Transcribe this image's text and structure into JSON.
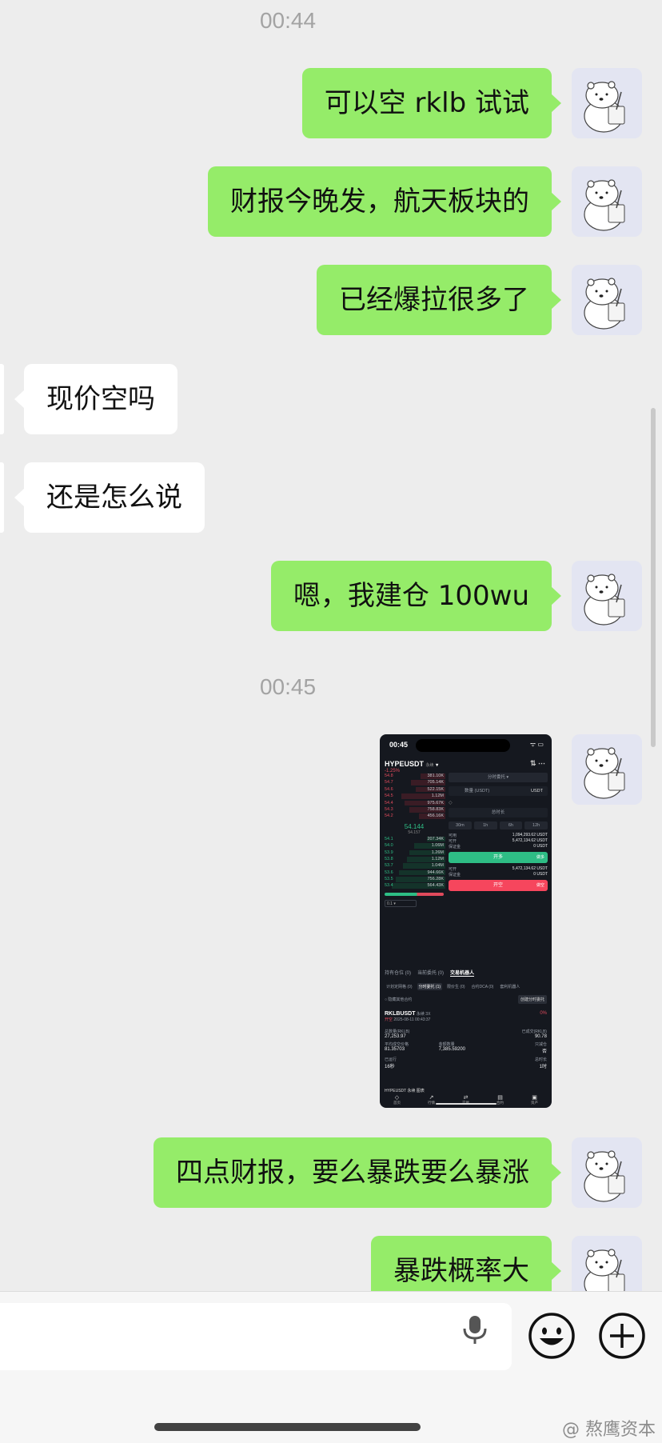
{
  "timestamps": [
    "00:44",
    "00:45"
  ],
  "messages": [
    {
      "side": "out",
      "text": "可以空 rklb 试试"
    },
    {
      "side": "out",
      "text": "财报今晚发，航天板块的"
    },
    {
      "side": "out",
      "text": "已经爆拉很多了"
    },
    {
      "side": "in",
      "text": "现价空吗"
    },
    {
      "side": "in",
      "text": "还是怎么说"
    },
    {
      "side": "out",
      "text": "嗯，我建仓 100wu"
    },
    {
      "side": "out",
      "text": "四点财报，要么暴跌要么暴涨"
    },
    {
      "side": "out",
      "text": "暴跌概率大"
    }
  ],
  "screenshot": {
    "time": "00:45",
    "pair": "HYPEUSDT",
    "pair_tag": "永续",
    "change": "-1.25%",
    "asks": [
      {
        "price": "54.8",
        "qty": "381.10K"
      },
      {
        "price": "54.7",
        "qty": "705.14K"
      },
      {
        "price": "54.6",
        "qty": "522.15K"
      },
      {
        "price": "54.5",
        "qty": "1.12M"
      },
      {
        "price": "54.4",
        "qty": "975.67K"
      },
      {
        "price": "54.3",
        "qty": "758.83K"
      },
      {
        "price": "54.2",
        "qty": "456.16K"
      }
    ],
    "mid_price": "54.144",
    "mid_sub": "54.157",
    "bids": [
      {
        "price": "54.1",
        "qty": "207.34K"
      },
      {
        "price": "54.0",
        "qty": "1.06M"
      },
      {
        "price": "53.9",
        "qty": "1.26M"
      },
      {
        "price": "53.8",
        "qty": "1.12M"
      },
      {
        "price": "53.7",
        "qty": "1.04M"
      },
      {
        "price": "53.6",
        "qty": "944.66K"
      },
      {
        "price": "53.5",
        "qty": "756.28K"
      },
      {
        "price": "53.4",
        "qty": "564.43K"
      }
    ],
    "precision": "0.1",
    "order_type": "分时委托",
    "qty_placeholder": "数量 (USDT)",
    "qty_unit": "USDT",
    "duration_placeholder": "总时长",
    "durations": [
      "30m",
      "1h",
      "6h",
      "12h"
    ],
    "available_label": "可用",
    "available_value": "1,094,293.62 USDT",
    "can_open_label": "可开",
    "can_open_value": "5,472,134.62 USDT",
    "margin_label": "保证金",
    "margin_value": "0 USDT",
    "can_open_value2": "5,472,134.62 USDT",
    "margin_value2": "0 USDT",
    "long_btn": "开多",
    "long_tag": "做多",
    "short_btn": "开空",
    "short_tag": "做空",
    "tabs": [
      "持有仓位 (0)",
      "当前委托 (0)",
      "交易机器人"
    ],
    "subtabs": [
      "计划定网格 (0)",
      "分时委托 (1)",
      "限价生 (0)",
      "合约DCA (0)",
      "套利机器人"
    ],
    "hide_label": "隐藏其他合约",
    "create_btn": "创建分时委托",
    "order": {
      "symbol": "RKLBUSDT",
      "tag1": "永续",
      "tag2": "3X",
      "side": "开空",
      "datetime": "2025-08-11 00:43:37",
      "pct": "0%",
      "fields": [
        {
          "label": "总数量(RKLB)",
          "value": "27,253.97"
        },
        {
          "label": "",
          "value": ""
        },
        {
          "label": "已成交(RKLB)",
          "value": "90.78"
        },
        {
          "label": "平均成交价格",
          "value": "81.35703"
        },
        {
          "label": "金额数量",
          "value": "7,385.59200"
        },
        {
          "label": "只减仓",
          "value": "否"
        },
        {
          "label": "已运行",
          "value": "16秒"
        },
        {
          "label": "",
          "value": ""
        },
        {
          "label": "总时长",
          "value": "1时"
        }
      ]
    },
    "footer": "HYPEUSDT 永续 图表",
    "nav": [
      {
        "icon": "◇",
        "label": "首页"
      },
      {
        "icon": "↗",
        "label": "行情"
      },
      {
        "icon": "⇄",
        "label": "交易"
      },
      {
        "icon": "▤",
        "label": "合约"
      },
      {
        "icon": "▣",
        "label": "资产"
      }
    ]
  },
  "watermark": "@ 熬鹰资本"
}
